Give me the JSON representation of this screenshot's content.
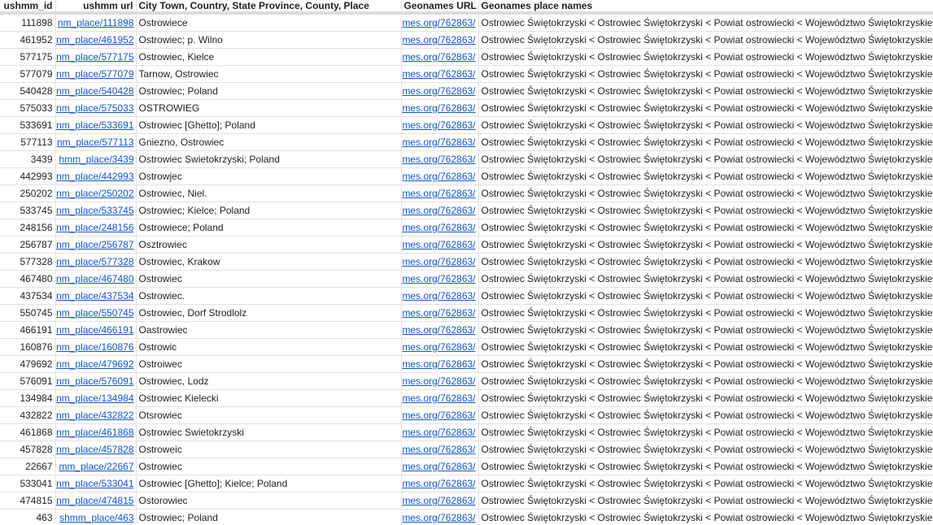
{
  "columns": {
    "id": "ushmm_id",
    "url": "ushmm url",
    "place": "City Town, Country, State Province, County, Place",
    "geo": "Geonames URL",
    "names": "Geonames place names"
  },
  "geonames_url_text": "mes.org/762863/",
  "geonames_names_text": "Ostrowiec Świętokrzyski < Ostrowiec Świętokrzyski < Powiat ostrowiecki < Województwo Świętokrzyskie",
  "rows": [
    {
      "id": "111898",
      "url": "nm_place/111898",
      "place": "Ostrowiece"
    },
    {
      "id": "461952",
      "url": "nm_place/461952",
      "place": "Ostrowiec; p. Wilno"
    },
    {
      "id": "577175",
      "url": "nm_place/577175",
      "place": "Ostrowiec, Kielce"
    },
    {
      "id": "577079",
      "url": "nm_place/577079",
      "place": "Tarnow, Ostrowiec"
    },
    {
      "id": "540428",
      "url": "nm_place/540428",
      "place": "Ostrowiec; Poland"
    },
    {
      "id": "575033",
      "url": "nm_place/575033",
      "place": "OSTROWIEG"
    },
    {
      "id": "533691",
      "url": "nm_place/533691",
      "place": "Ostrowiec [Ghetto]; Poland"
    },
    {
      "id": "577113",
      "url": "nm_place/577113",
      "place": "Gniezno, Ostrowiec"
    },
    {
      "id": "3439",
      "url": "hmm_place/3439",
      "place": "Ostrowiec Swietokrzyski; Poland"
    },
    {
      "id": "442993",
      "url": "nm_place/442993",
      "place": "Ostrowjec"
    },
    {
      "id": "250202",
      "url": "nm_place/250202",
      "place": "Ostrowiec, Niel."
    },
    {
      "id": "533745",
      "url": "nm_place/533745",
      "place": "Ostrowiec; Kielce; Poland"
    },
    {
      "id": "248156",
      "url": "nm_place/248156",
      "place": "Ostrowiece; Poland"
    },
    {
      "id": "256787",
      "url": "nm_place/256787",
      "place": "Osztrowiec"
    },
    {
      "id": "577328",
      "url": "nm_place/577328",
      "place": "Ostrowiec, Krakow"
    },
    {
      "id": "467480",
      "url": "nm_place/467480",
      "place": "Ostrowiec"
    },
    {
      "id": "437534",
      "url": "nm_place/437534",
      "place": "Ostrowiec."
    },
    {
      "id": "550745",
      "url": "nm_place/550745",
      "place": "Ostrowiec, Dorf Strodlolz"
    },
    {
      "id": "466191",
      "url": "nm_place/466191",
      "place": "Oastrowiec"
    },
    {
      "id": "160876",
      "url": "nm_place/160876",
      "place": "Ostrowic"
    },
    {
      "id": "479692",
      "url": "nm_place/479692",
      "place": "Ostroiwec"
    },
    {
      "id": "576091",
      "url": "nm_place/576091",
      "place": "Ostrowiec, Lodz"
    },
    {
      "id": "134984",
      "url": "nm_place/134984",
      "place": "Ostrowiec Kielecki"
    },
    {
      "id": "432822",
      "url": "nm_place/432822",
      "place": "Otsrowiec"
    },
    {
      "id": "461868",
      "url": "nm_place/461868",
      "place": "Ostrowiec Swietokrzyski"
    },
    {
      "id": "457828",
      "url": "nm_place/457828",
      "place": "Ostroweic"
    },
    {
      "id": "22667",
      "url": "mm_place/22667",
      "place": "Ostrowiec"
    },
    {
      "id": "533041",
      "url": "nm_place/533041",
      "place": "Ostrowiec [Ghetto]; Kielce; Poland"
    },
    {
      "id": "474815",
      "url": "nm_place/474815",
      "place": "Ostorowiec"
    },
    {
      "id": "463",
      "url": "shmm_place/463",
      "place": "Ostrowiec; Poland"
    }
  ]
}
